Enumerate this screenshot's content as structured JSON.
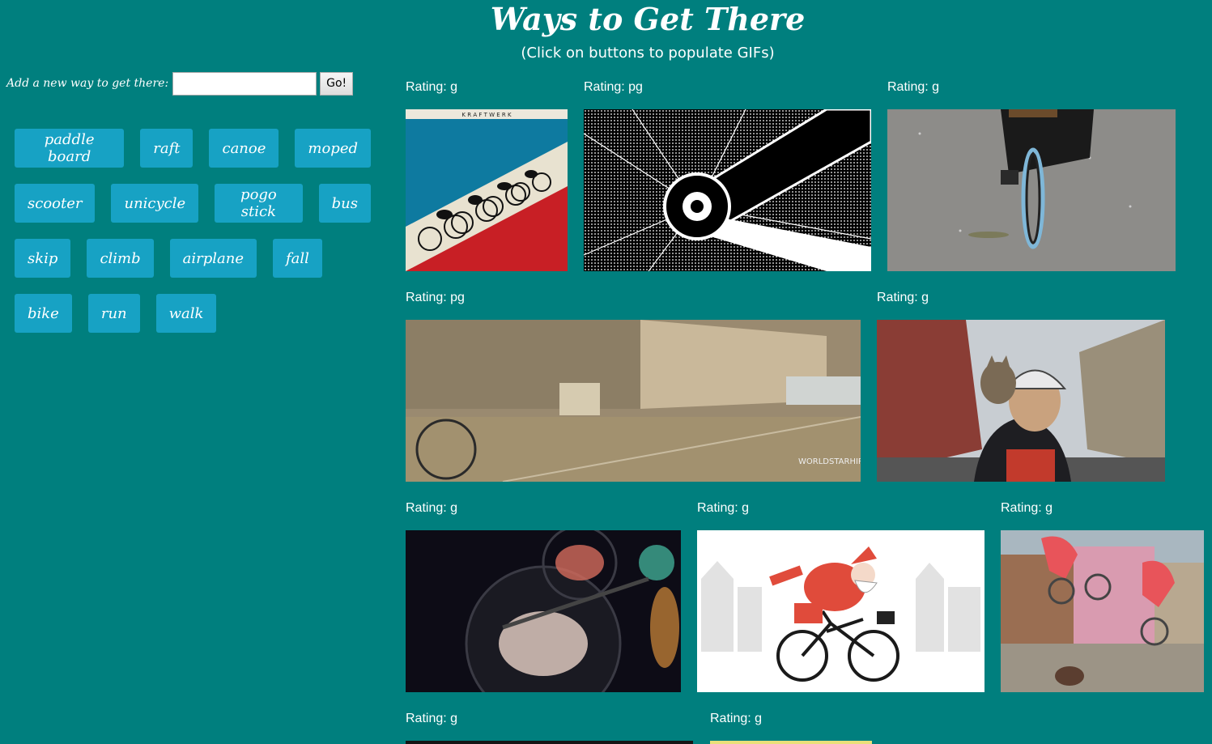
{
  "header": {
    "title": "Ways to Get There",
    "subtitle": "(Click on buttons to populate GIFs)"
  },
  "add_form": {
    "label": "Add a new way to get there:",
    "input_value": "",
    "go_label": "Go!"
  },
  "buttons": [
    [
      "paddle board",
      "raft",
      "canoe",
      "moped"
    ],
    [
      "scooter",
      "unicycle",
      "pogo stick",
      "bus"
    ],
    [
      "skip",
      "climb",
      "airplane",
      "fall"
    ],
    [
      "bike",
      "run",
      "walk"
    ]
  ],
  "gifs": [
    {
      "rating": "Rating: g",
      "subject": "kraftwerk-cyclists",
      "caption_text": "K R A F T W E R K"
    },
    {
      "rating": "Rating: pg",
      "subject": "bike-gear-halftone"
    },
    {
      "rating": "Rating: g",
      "subject": "bicycle-front-wheel"
    },
    {
      "rating": "Rating: pg",
      "subject": "street-cyclist-blur",
      "caption_text": "WORLDSTARHIPHOP.COM"
    },
    {
      "rating": "Rating: g",
      "subject": "cat-on-cyclist-shoulder"
    },
    {
      "rating": "Rating: g",
      "subject": "bike-wheel-lights-night"
    },
    {
      "rating": "Rating: g",
      "subject": "santa-on-bicycle"
    },
    {
      "rating": "Rating: g",
      "subject": "bmx-jump-red-hoodie"
    },
    {
      "rating": "Rating: g",
      "subject": "gif-partially-visible"
    },
    {
      "rating": "Rating: g",
      "subject": "gif-partially-visible"
    }
  ]
}
